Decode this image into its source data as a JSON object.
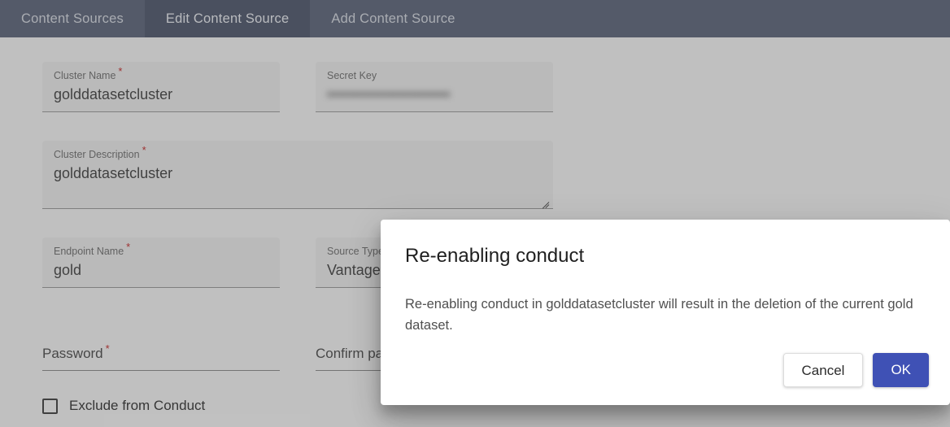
{
  "tabs": [
    {
      "label": "Content Sources",
      "active": false
    },
    {
      "label": "Edit Content Source",
      "active": true
    },
    {
      "label": "Add Content Source",
      "active": false
    }
  ],
  "form": {
    "cluster_name": {
      "label": "Cluster Name",
      "required_marker": "*",
      "value": "golddatasetcluster"
    },
    "secret_key": {
      "label": "Secret Key",
      "required_marker": "",
      "value": "••••••••••••••••••••••••"
    },
    "cluster_description": {
      "label": "Cluster Description",
      "required_marker": "*",
      "value": "golddatasetcluster"
    },
    "endpoint_name": {
      "label": "Endpoint Name",
      "required_marker": "*",
      "value": "gold"
    },
    "source_type": {
      "label": "Source Type",
      "required_marker": "",
      "value": "Vantage"
    },
    "password": {
      "label": "Password",
      "required_marker": "*",
      "value": ""
    },
    "confirm_password": {
      "label": "Confirm password",
      "required_marker": "*",
      "value": ""
    },
    "exclude_from_conduct": {
      "label": "Exclude from Conduct",
      "checked": false
    }
  },
  "dialog": {
    "title": "Re-enabling conduct",
    "message": "Re-enabling conduct in golddatasetcluster will result in the deletion of the current gold dataset.",
    "cancel_label": "Cancel",
    "ok_label": "OK"
  },
  "colors": {
    "header_bar": "#5b6479",
    "header_tab_active": "#4c556a",
    "primary_button": "#3f51b5",
    "required_asterisk": "#c62828"
  }
}
